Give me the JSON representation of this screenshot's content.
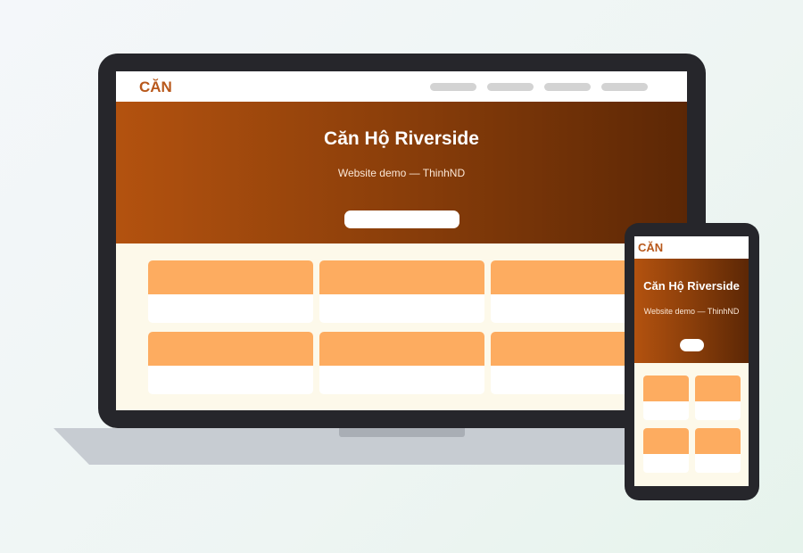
{
  "brand": {
    "accent": "#b8581b",
    "hero_start": "#b3520f",
    "hero_end": "#5c2705",
    "card_image": "#fdac60",
    "page_bg": "#fdf9ea"
  },
  "desktop": {
    "logo": "CĂN",
    "nav_links": [
      "",
      "",
      "",
      ""
    ],
    "hero": {
      "title": "Căn Hộ Riverside",
      "subtitle": "Website demo — ThinhND",
      "cta_label": ""
    },
    "cards": [
      {},
      {},
      {},
      {},
      {},
      {}
    ]
  },
  "mobile": {
    "logo": "CĂN",
    "hero": {
      "title": "Căn Hộ Riverside",
      "subtitle": "Website demo — ThinhND",
      "cta_label": ""
    },
    "cards": [
      {},
      {},
      {},
      {}
    ]
  }
}
